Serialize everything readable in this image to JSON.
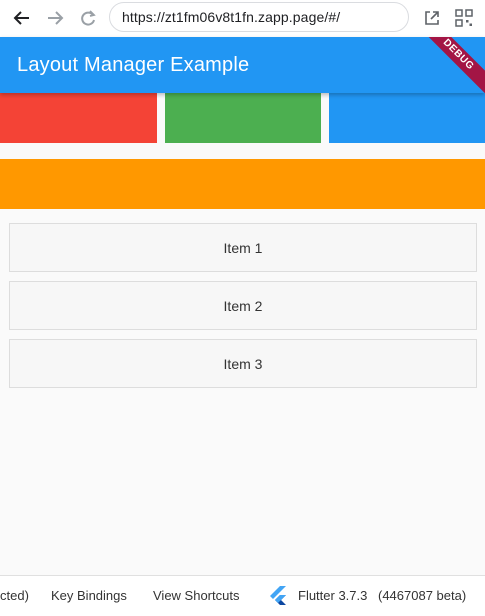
{
  "browser": {
    "url": "https://zt1fm06v8t1fn.zapp.page/#/",
    "icons": [
      "back-arrow-icon",
      "forward-arrow-icon",
      "reload-icon",
      "open-external-icon",
      "qr-code-icon"
    ]
  },
  "app_bar": {
    "title": "Layout Manager Example",
    "debug_label": "DEBUG",
    "color": "#2196f3"
  },
  "color_boxes": [
    {
      "name": "red",
      "color": "#f44336"
    },
    {
      "name": "green",
      "color": "#4caf50"
    },
    {
      "name": "blue",
      "color": "#2196f3"
    }
  ],
  "orange_bar": {
    "color": "#ff9800"
  },
  "list": {
    "items": [
      "Item 1",
      "Item 2",
      "Item 3"
    ]
  },
  "bottom_bar": {
    "truncated": "cted)",
    "key_bindings": "Key Bindings",
    "view_shortcuts": "View Shortcuts",
    "flutter_version": "Flutter 3.7.3",
    "build": "(4467087 beta)"
  }
}
